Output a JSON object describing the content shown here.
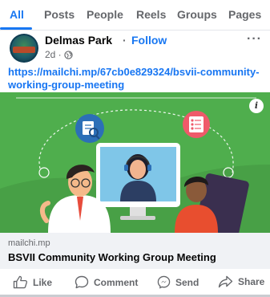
{
  "tabs": [
    {
      "label": "All",
      "active": true
    },
    {
      "label": "Posts",
      "active": false
    },
    {
      "label": "People",
      "active": false
    },
    {
      "label": "Reels",
      "active": false
    },
    {
      "label": "Groups",
      "active": false
    },
    {
      "label": "Pages",
      "active": false
    }
  ],
  "post": {
    "author": "Delmas Park",
    "separator": "·",
    "follow_label": "Follow",
    "time": "2d ·",
    "privacy_icon": "globe-icon",
    "more_label": "···",
    "link_text": "https://mailchi.mp/67cb0e829324/bsvii-community-working-group-meeting",
    "preview": {
      "info_label": "i",
      "background": "#4fae4d"
    },
    "domain": "mailchi.mp",
    "link_title": "BSVII Community Working Group Meeting"
  },
  "actions": [
    {
      "label": "Like",
      "icon": "thumbs-up-icon"
    },
    {
      "label": "Comment",
      "icon": "comment-icon"
    },
    {
      "label": "Send",
      "icon": "messenger-icon"
    },
    {
      "label": "Share",
      "icon": "share-icon"
    }
  ],
  "colors": {
    "accent": "#1877f2",
    "text": "#050505",
    "muted": "#65676b",
    "link_meta_bg": "#f0f2f5"
  }
}
